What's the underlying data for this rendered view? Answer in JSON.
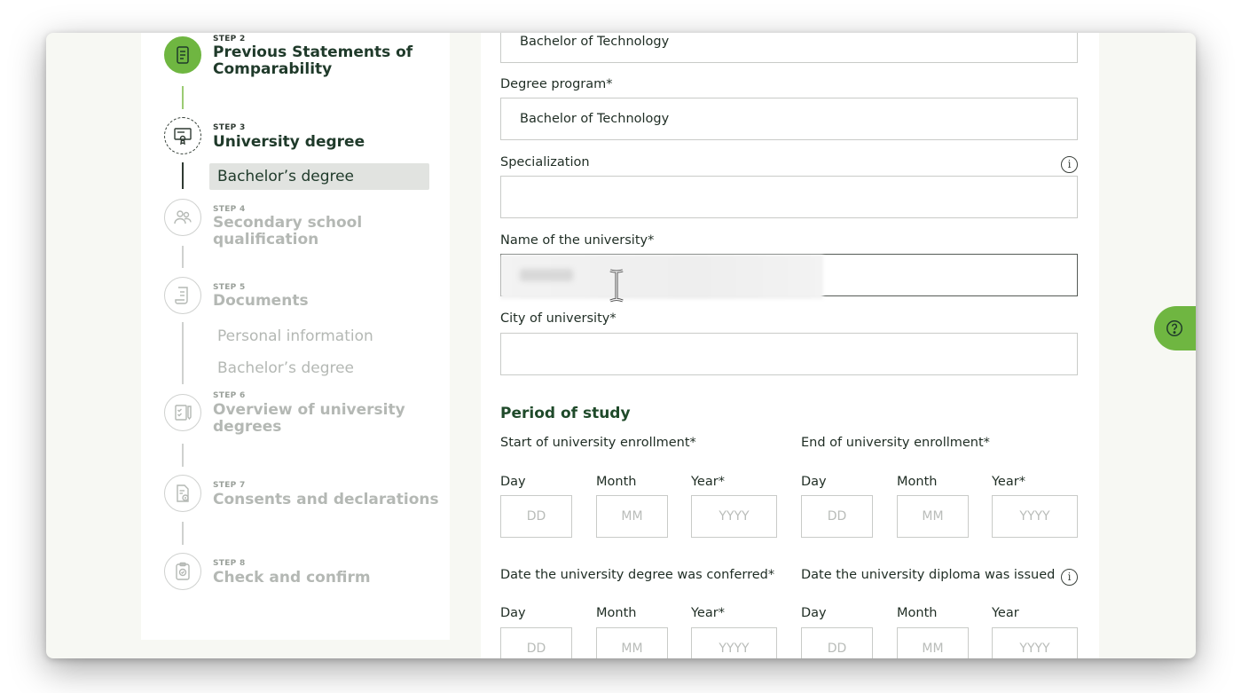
{
  "stepper": {
    "step2": {
      "num": "STEP 2",
      "title_line1": "Previous Statements of",
      "title_line2": "Comparability"
    },
    "step3": {
      "num": "STEP 3",
      "title": "University degree",
      "substep": "Bachelor’s degree"
    },
    "step4": {
      "num": "STEP 4",
      "title": "Secondary school qualification"
    },
    "step5": {
      "num": "STEP 5",
      "title": "Documents",
      "substeps": [
        "Personal information",
        "Bachelor’s degree"
      ]
    },
    "step6": {
      "num": "STEP 6",
      "title_line1": "Overview of university",
      "title_line2": "degrees"
    },
    "step7": {
      "num": "STEP 7",
      "title": "Consents and declarations"
    },
    "step8": {
      "num": "STEP 8",
      "title": "Check and confirm"
    }
  },
  "form": {
    "top_field_value": "Bachelor of Technology",
    "degree_program": {
      "label": "Degree program*",
      "value": "Bachelor of Technology"
    },
    "specialization": {
      "label": "Specialization",
      "value": ""
    },
    "university_name": {
      "label": "Name of the university*",
      "value": ""
    },
    "university_city": {
      "label": "City of university*",
      "value": ""
    },
    "period_title": "Period of study",
    "start_enrollment": {
      "label": "Start of university enrollment*",
      "day": "Day",
      "month": "Month",
      "year": "Year*",
      "ph_day": "DD",
      "ph_month": "MM",
      "ph_year": "YYYY"
    },
    "end_enrollment": {
      "label": "End of university enrollment*",
      "day": "Day",
      "month": "Month",
      "year": "Year*",
      "ph_day": "DD",
      "ph_month": "MM",
      "ph_year": "YYYY"
    },
    "degree_conferred": {
      "label": "Date the university degree was conferred*",
      "day": "Day",
      "month": "Month",
      "year": "Year*",
      "ph_day": "DD",
      "ph_month": "MM",
      "ph_year": "YYYY"
    },
    "diploma_issued": {
      "label": "Date the university diploma was issued",
      "day": "Day",
      "month": "Month",
      "year": "Year",
      "ph_day": "DD",
      "ph_month": "MM",
      "ph_year": "YYYY"
    }
  },
  "icons": {
    "info": "info-icon",
    "help": "help-question-icon"
  },
  "colors": {
    "brand_green": "#6fb641",
    "title_green": "#1f4a2a",
    "muted": "#b4b8b4"
  }
}
